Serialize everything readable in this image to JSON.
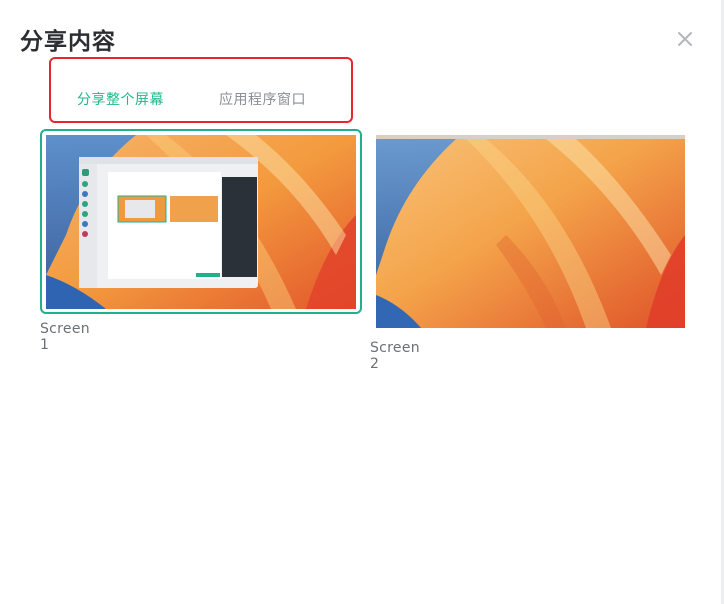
{
  "dialog": {
    "title": "分享内容",
    "close_icon": "close-icon"
  },
  "tabs": [
    {
      "label": "分享整个屏幕",
      "active": true
    },
    {
      "label": "应用程序窗口",
      "active": false
    }
  ],
  "screens": [
    {
      "label": "Screen 1",
      "selected": true
    },
    {
      "label": "Screen 2",
      "selected": false
    }
  ],
  "colors": {
    "accent": "#1fb88a",
    "highlight_box": "#e8262c",
    "inactive_tab": "#8a8f96"
  }
}
